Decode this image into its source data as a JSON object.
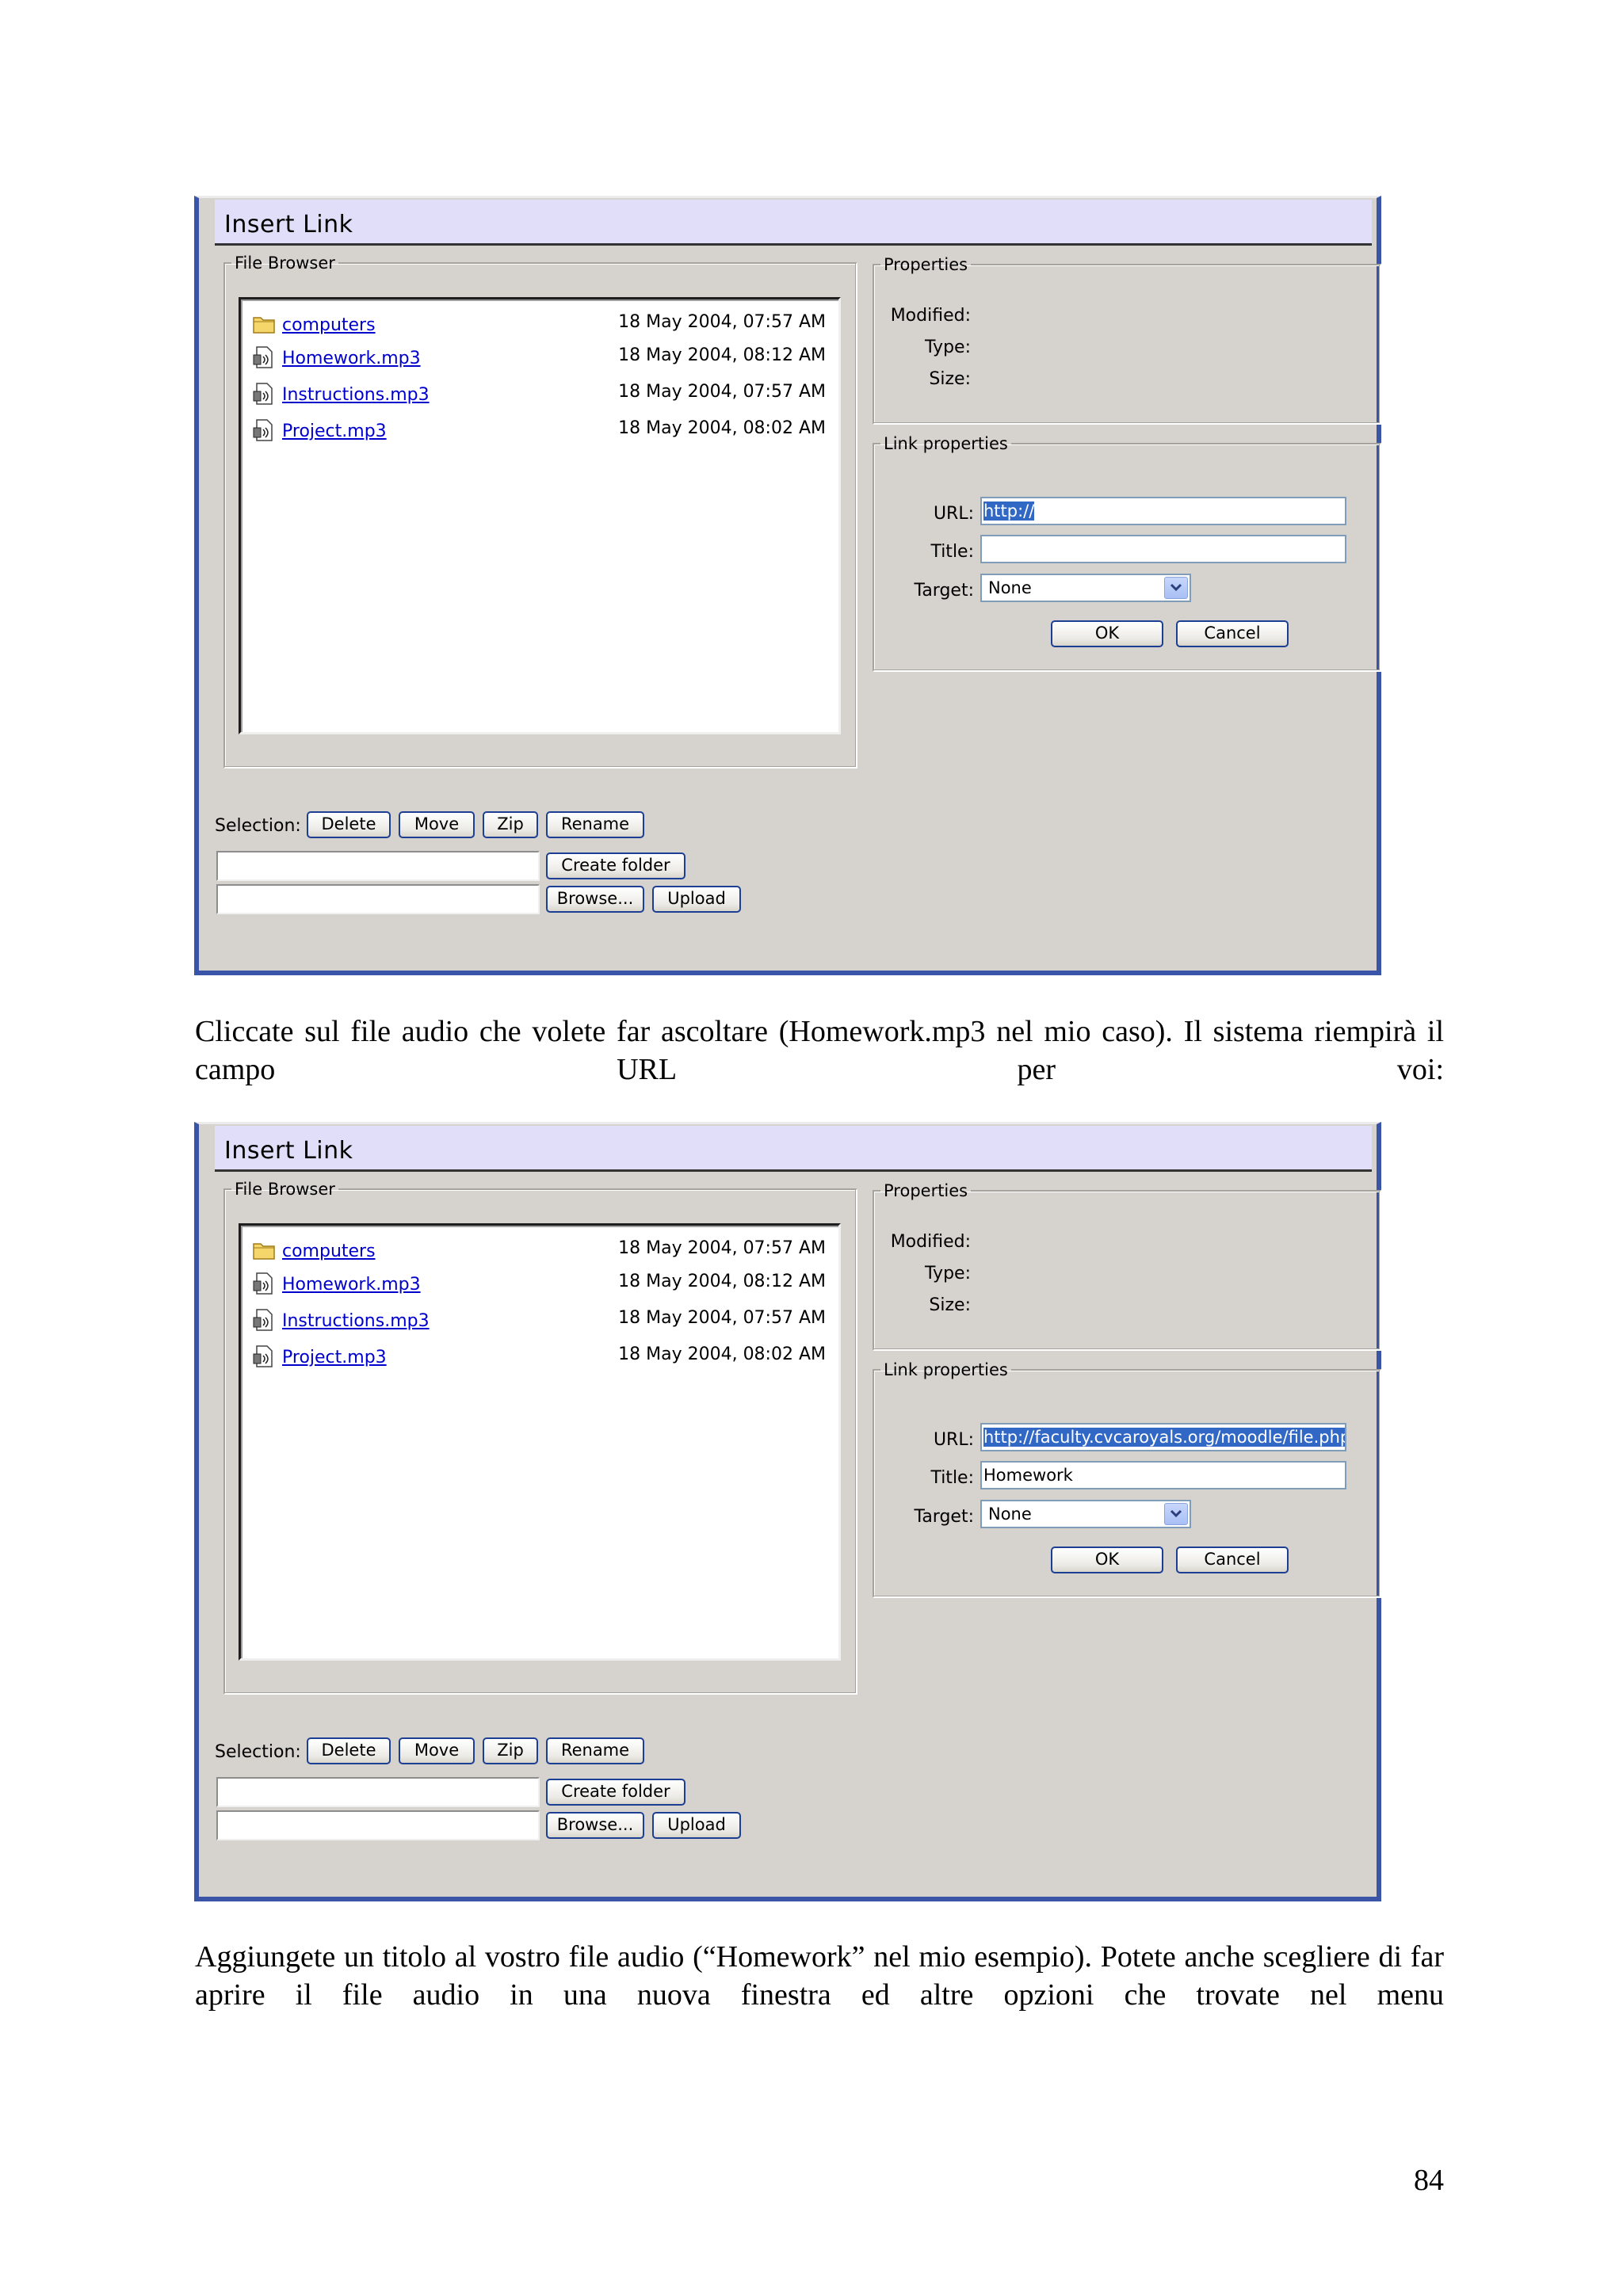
{
  "dialogs": [
    {
      "title": "Insert Link",
      "file_browser": {
        "legend": "File Browser",
        "files": [
          {
            "name": "computers",
            "date": "18 May 2004, 07:57 AM",
            "icon": "folder-icon"
          },
          {
            "name": "Homework.mp3",
            "date": "18 May 2004, 08:12 AM",
            "icon": "audio-file-icon"
          },
          {
            "name": "Instructions.mp3",
            "date": "18 May 2004, 07:57 AM",
            "icon": "audio-file-icon"
          },
          {
            "name": "Project.mp3",
            "date": "18 May 2004, 08:02 AM",
            "icon": "audio-file-icon"
          }
        ]
      },
      "properties": {
        "legend": "Properties",
        "modified_label": "Modified:",
        "type_label": "Type:",
        "size_label": "Size:"
      },
      "link_properties": {
        "legend": "Link properties",
        "url_label": "URL:",
        "url_value": "http://",
        "title_label": "Title:",
        "title_value": "",
        "target_label": "Target:",
        "target_value": "None",
        "ok": "OK",
        "cancel": "Cancel"
      },
      "selection": {
        "label": "Selection:",
        "delete": "Delete",
        "move": "Move",
        "zip": "Zip",
        "rename": "Rename",
        "create_folder": "Create folder",
        "browse": "Browse...",
        "upload": "Upload"
      }
    },
    {
      "title": "Insert Link",
      "file_browser": {
        "legend": "File Browser",
        "files": [
          {
            "name": "computers",
            "date": "18 May 2004, 07:57 AM",
            "icon": "folder-icon"
          },
          {
            "name": "Homework.mp3",
            "date": "18 May 2004, 08:12 AM",
            "icon": "audio-file-icon"
          },
          {
            "name": "Instructions.mp3",
            "date": "18 May 2004, 07:57 AM",
            "icon": "audio-file-icon"
          },
          {
            "name": "Project.mp3",
            "date": "18 May 2004, 08:02 AM",
            "icon": "audio-file-icon"
          }
        ]
      },
      "properties": {
        "legend": "Properties",
        "modified_label": "Modified:",
        "type_label": "Type:",
        "size_label": "Size:"
      },
      "link_properties": {
        "legend": "Link properties",
        "url_label": "URL:",
        "url_value": "http://faculty.cvcaroyals.org/moodle/file.php",
        "title_label": "Title:",
        "title_value": "Homework",
        "target_label": "Target:",
        "target_value": "None",
        "ok": "OK",
        "cancel": "Cancel"
      },
      "selection": {
        "label": "Selection:",
        "delete": "Delete",
        "move": "Move",
        "zip": "Zip",
        "rename": "Rename",
        "create_folder": "Create folder",
        "browse": "Browse...",
        "upload": "Upload"
      }
    }
  ],
  "paragraphs": {
    "p1": "Cliccate sul file audio che volete far ascoltare (Homework.mp3 nel mio caso). Il sistema riempirà il campo URL per voi:",
    "p2": "Aggiungete un titolo al vostro file audio (“Homework” nel mio esempio). Potete anche scegliere di far aprire il file audio in una nuova finestra ed altre opzioni che trovate nel menu"
  },
  "page_number": "84",
  "colors": {
    "dialog_bg": "#d6d3ce",
    "dialog_border": "#3a55a8",
    "title_bg": "#e0def9",
    "link_color": "#0000cc",
    "selection_bg": "#3168c6"
  }
}
